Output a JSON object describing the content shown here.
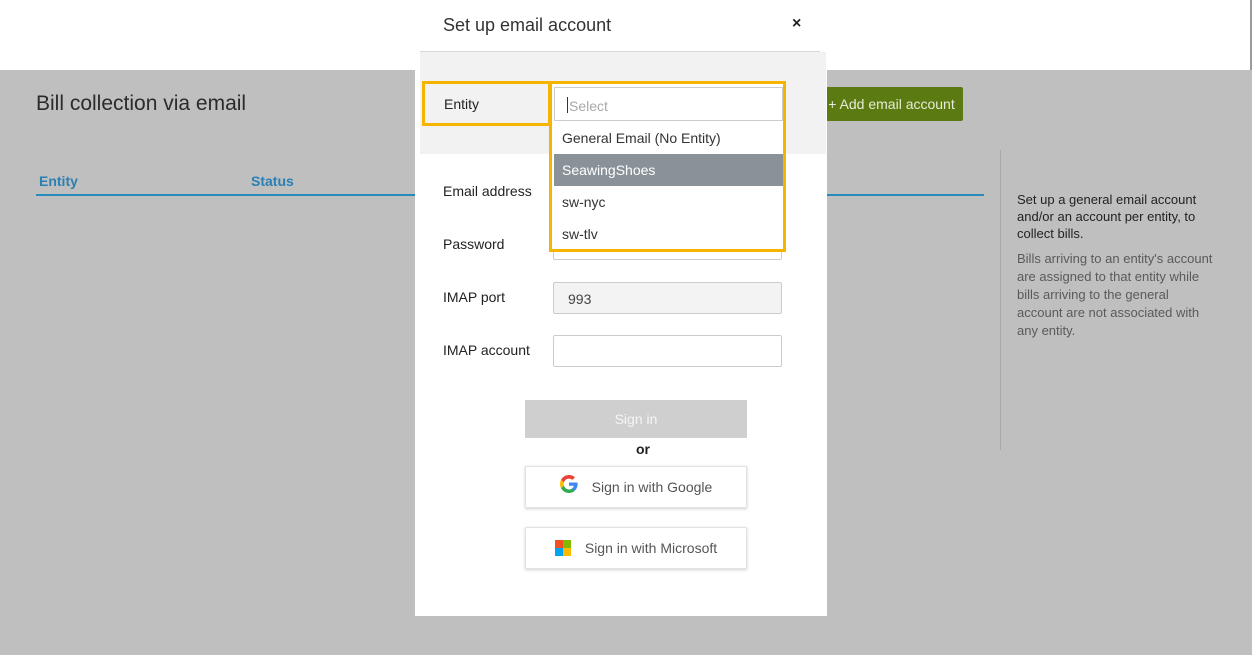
{
  "page": {
    "title": "Bill collection via email",
    "add_button": "+ Add email account",
    "table_headers": [
      "Entity",
      "Status"
    ],
    "side_info": {
      "main": "Set up a general email account and/or an account per entity, to collect bills.",
      "sub": "Bills arriving to an entity's account are assigned to that entity while bills arriving to the general account are not associated with any entity."
    }
  },
  "modal": {
    "title": "Set up email account",
    "close": "×",
    "entity_label": "Entity",
    "email_label": "Email address",
    "password_label": "Password",
    "imap_port_label": "IMAP port",
    "imap_port_value": "993",
    "imap_account_label": "IMAP account",
    "select_placeholder": "Select",
    "dropdown_options": [
      "General Email (No Entity)",
      "SeawingShoes",
      "sw-nyc",
      "sw-tlv"
    ],
    "selected_option": "SeawingShoes",
    "sign_in": "Sign in",
    "or": "or",
    "google": "Sign in with Google",
    "microsoft": "Sign in with Microsoft"
  },
  "colors": {
    "accent_highlight": "#f4b400",
    "add_button_bg": "#5b7a12",
    "header_link": "#2a7fb3",
    "selected_option_bg": "#8a9299"
  },
  "icons": {
    "close": "close-icon",
    "google": "google-icon",
    "microsoft": "microsoft-icon"
  }
}
